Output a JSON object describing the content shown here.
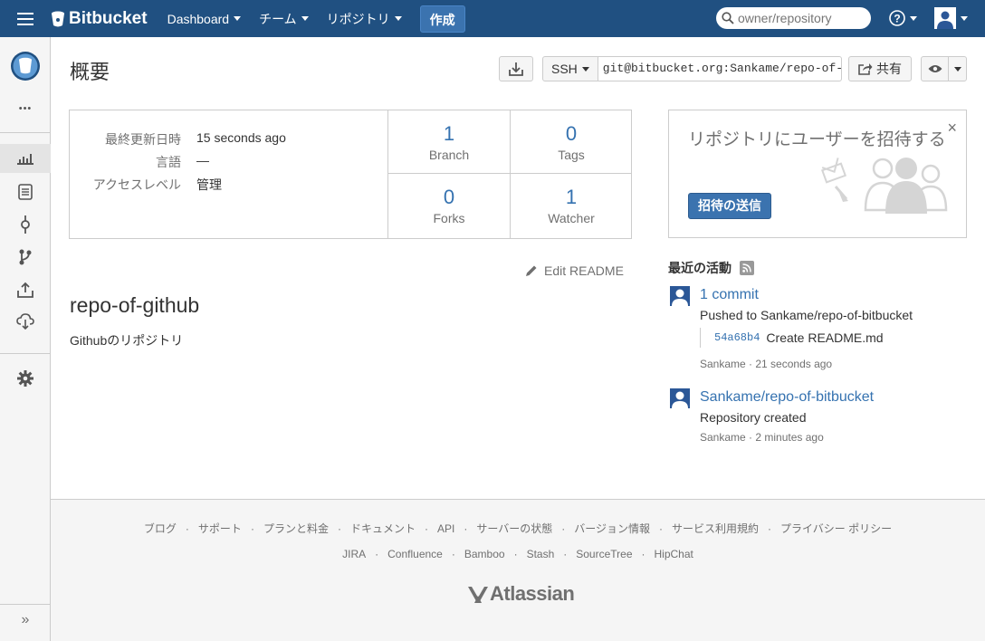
{
  "header": {
    "brand": "Bitbucket",
    "nav": [
      {
        "label": "Dashboard"
      },
      {
        "label": "チーム"
      },
      {
        "label": "リポジトリ"
      }
    ],
    "create_label": "作成",
    "search_placeholder": "owner/repository"
  },
  "page": {
    "title": "概要",
    "clone_protocol": "SSH",
    "clone_url": "git@bitbucket.org:Sankame/repo-of-bitbucket.git",
    "share_label": "共有"
  },
  "meta": {
    "rows": [
      {
        "key": "最終更新日時",
        "value": "15 seconds ago"
      },
      {
        "key": "言語",
        "value": "—"
      },
      {
        "key": "アクセスレベル",
        "value": "管理"
      }
    ]
  },
  "stats": [
    {
      "num": "1",
      "label": "Branch"
    },
    {
      "num": "0",
      "label": "Tags"
    },
    {
      "num": "0",
      "label": "Forks"
    },
    {
      "num": "1",
      "label": "Watcher"
    }
  ],
  "readme": {
    "edit_label": "Edit README",
    "title": "repo-of-github",
    "text": "Githubのリポジトリ"
  },
  "invite": {
    "text": "リポジトリにユーザーを招待する",
    "button": "招待の送信",
    "close": "×"
  },
  "activity": {
    "title": "最近の活動",
    "items": [
      {
        "link": "1 commit",
        "desc": "Pushed to Sankame/repo-of-bitbucket",
        "hash": "54a68b4",
        "message": "Create README.md",
        "meta": "Sankame · 21 seconds ago"
      },
      {
        "link": "Sankame/repo-of-bitbucket",
        "desc": "Repository created",
        "meta": "Sankame · 2 minutes ago"
      }
    ]
  },
  "footer": {
    "links1": [
      "ブログ",
      "サポート",
      "プランと料金",
      "ドキュメント",
      "API",
      "サーバーの状態",
      "バージョン情報",
      "サービス利用規約",
      "プライバシー ポリシー"
    ],
    "links2": [
      "JIRA",
      "Confluence",
      "Bamboo",
      "Stash",
      "SourceTree",
      "HipChat"
    ],
    "brand": "Atlassian"
  },
  "sidebar": {
    "expand": "»",
    "more": "•••"
  },
  "colors": {
    "header_bg": "#205081",
    "link": "#3572b0",
    "button_primary": "#3b73af"
  }
}
